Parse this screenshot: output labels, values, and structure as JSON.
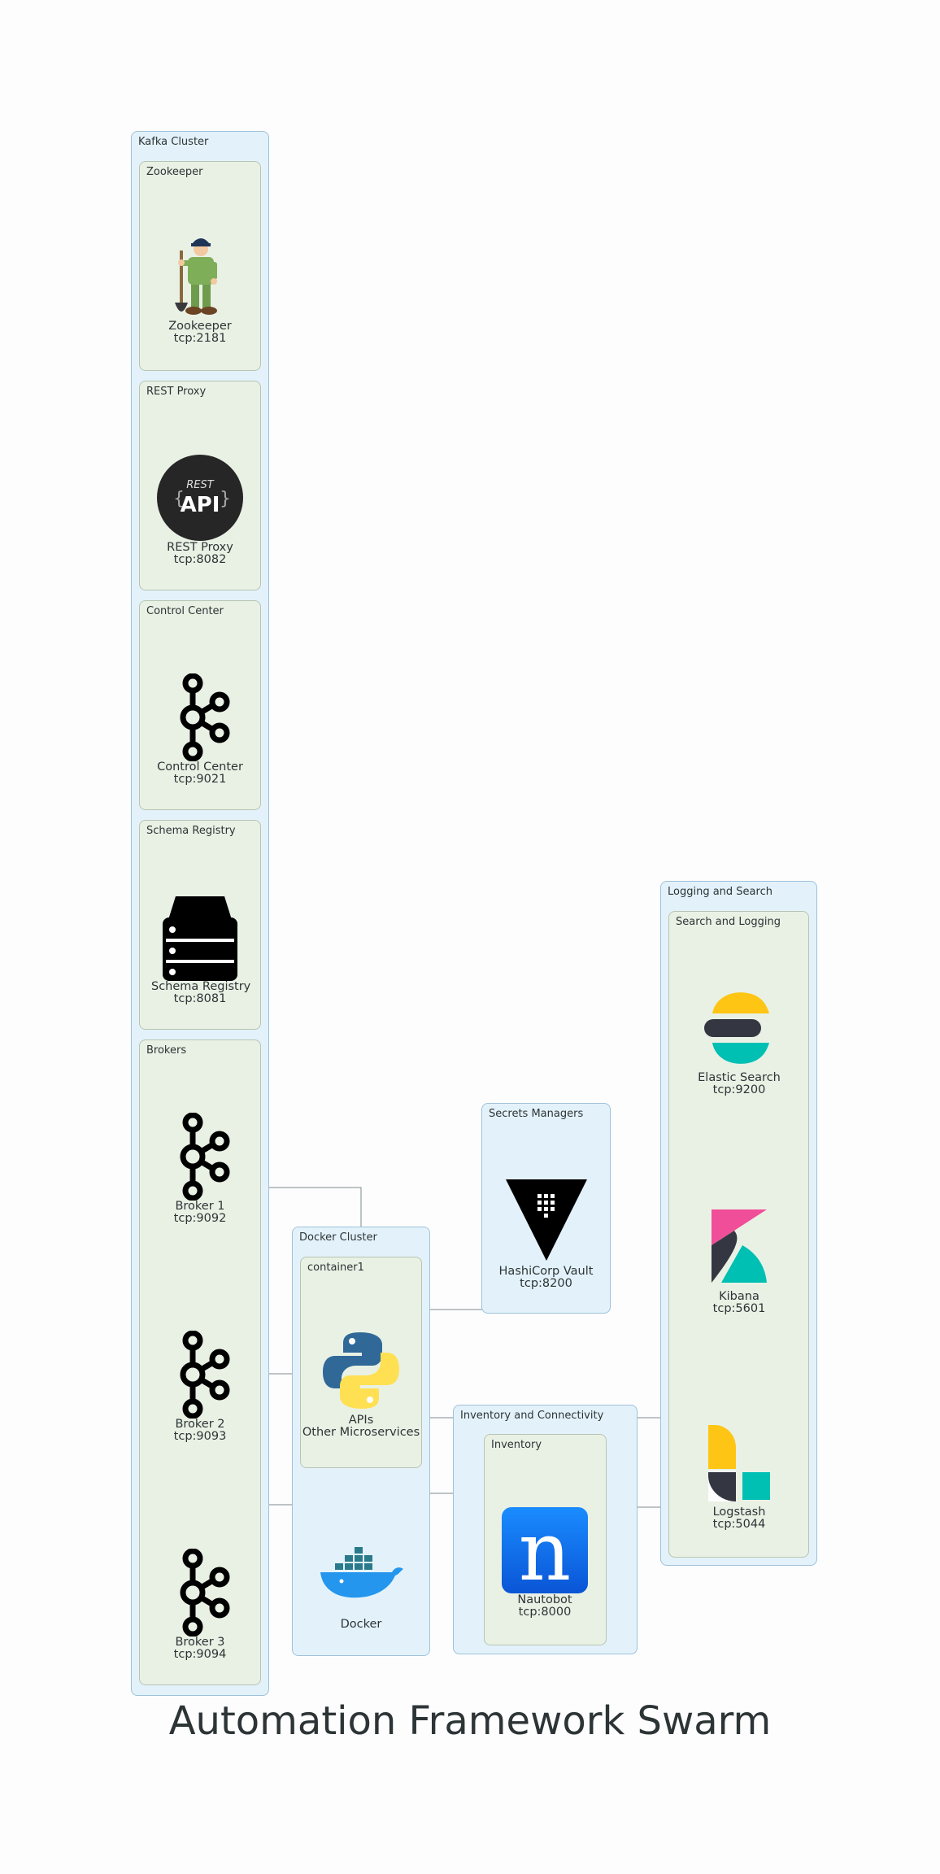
{
  "title": "Automation Framework Swarm",
  "clusters": {
    "kafka": "Kafka Cluster",
    "zookeeper": "Zookeeper",
    "rest_proxy": "REST Proxy",
    "control_center": "Control Center",
    "schema_registry": "Schema Registry",
    "brokers": "Brokers",
    "docker": "Docker Cluster",
    "container1": "container1",
    "secrets": "Secrets Managers",
    "inventory_conn": "Inventory and Connectivity",
    "inventory": "Inventory",
    "logging": "Logging and Search",
    "search_logging": "Search and Logging"
  },
  "nodes": {
    "zookeeper": {
      "name": "Zookeeper",
      "port": "tcp:2181",
      "icon": "zookeeper-icon"
    },
    "rest_proxy": {
      "name": "REST Proxy",
      "port": "tcp:8082",
      "icon": "rest-api-icon",
      "badge_small": "REST",
      "badge_big": "API"
    },
    "control_center": {
      "name": "Control Center",
      "port": "tcp:9021",
      "icon": "kafka-icon"
    },
    "schema_registry": {
      "name": "Schema Registry",
      "port": "tcp:8081",
      "icon": "database-stack-icon"
    },
    "broker1": {
      "name": "Broker 1",
      "port": "tcp:9092",
      "icon": "kafka-icon"
    },
    "broker2": {
      "name": "Broker 2",
      "port": "tcp:9093",
      "icon": "kafka-icon"
    },
    "broker3": {
      "name": "Broker 3",
      "port": "tcp:9094",
      "icon": "kafka-icon"
    },
    "apis": {
      "name": "APIs",
      "sub": "Other Microservices",
      "icon": "python-icon"
    },
    "docker": {
      "name": "Docker",
      "icon": "docker-whale-icon"
    },
    "vault": {
      "name": "HashiCorp Vault",
      "port": "tcp:8200",
      "icon": "vault-icon"
    },
    "nautobot": {
      "name": "Nautobot",
      "port": "tcp:8000",
      "icon": "nautobot-icon",
      "letter": "n"
    },
    "elastic": {
      "name": "Elastic Search",
      "port": "tcp:9200",
      "icon": "elasticsearch-icon"
    },
    "kibana": {
      "name": "Kibana",
      "port": "tcp:5601",
      "icon": "kibana-icon"
    },
    "logstash": {
      "name": "Logstash",
      "port": "tcp:5044",
      "icon": "logstash-icon"
    }
  },
  "colors": {
    "outer_cluster_fill": "#e3f2fa",
    "inner_cluster_fill": "#e9f1e5",
    "edge": "#7f8c8d",
    "python_blue": "#306998",
    "python_yellow": "#ffe052",
    "docker_blue": "#2496ed",
    "nautobot_blue": "#0a7cf0",
    "elastic_yellow": "#fec514",
    "elastic_teal": "#00bfb3",
    "elastic_dark": "#343741",
    "kibana_pink": "#f04e98"
  }
}
